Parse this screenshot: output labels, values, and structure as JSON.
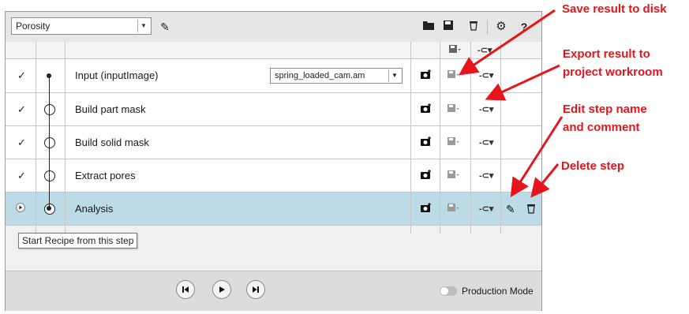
{
  "toolbar": {
    "recipe_value": "Porosity",
    "icons": [
      "edit-pencil-icon",
      "folder-open-icon",
      "save-icon",
      "trash-icon",
      "gear-icon",
      "help-icon"
    ],
    "help_label": "?"
  },
  "steps": [
    {
      "check": "✓",
      "label": "Input (inputImage)",
      "file": "spring_loaded_cam.am",
      "node": "dot"
    },
    {
      "check": "✓",
      "label": "Build part mask",
      "node": "circle"
    },
    {
      "check": "✓",
      "label": "Build solid mask",
      "node": "circle"
    },
    {
      "check": "✓",
      "label": "Extract pores",
      "node": "circle"
    },
    {
      "check": "▶",
      "label": "Analysis",
      "node": "selected",
      "selected": true
    }
  ],
  "tooltip": "Start Recipe from this step",
  "footer": {
    "production_mode_label": "Production Mode",
    "production_mode_on": false
  },
  "annotations": {
    "save": "Save result to disk",
    "export_line1": "Export result to",
    "export_line2": "project workroom",
    "edit_line1": "Edit step name",
    "edit_line2": "and comment",
    "delete": "Delete step"
  },
  "colors": {
    "annotation": "#e8141c",
    "selected_row": "#bcdbe6"
  }
}
